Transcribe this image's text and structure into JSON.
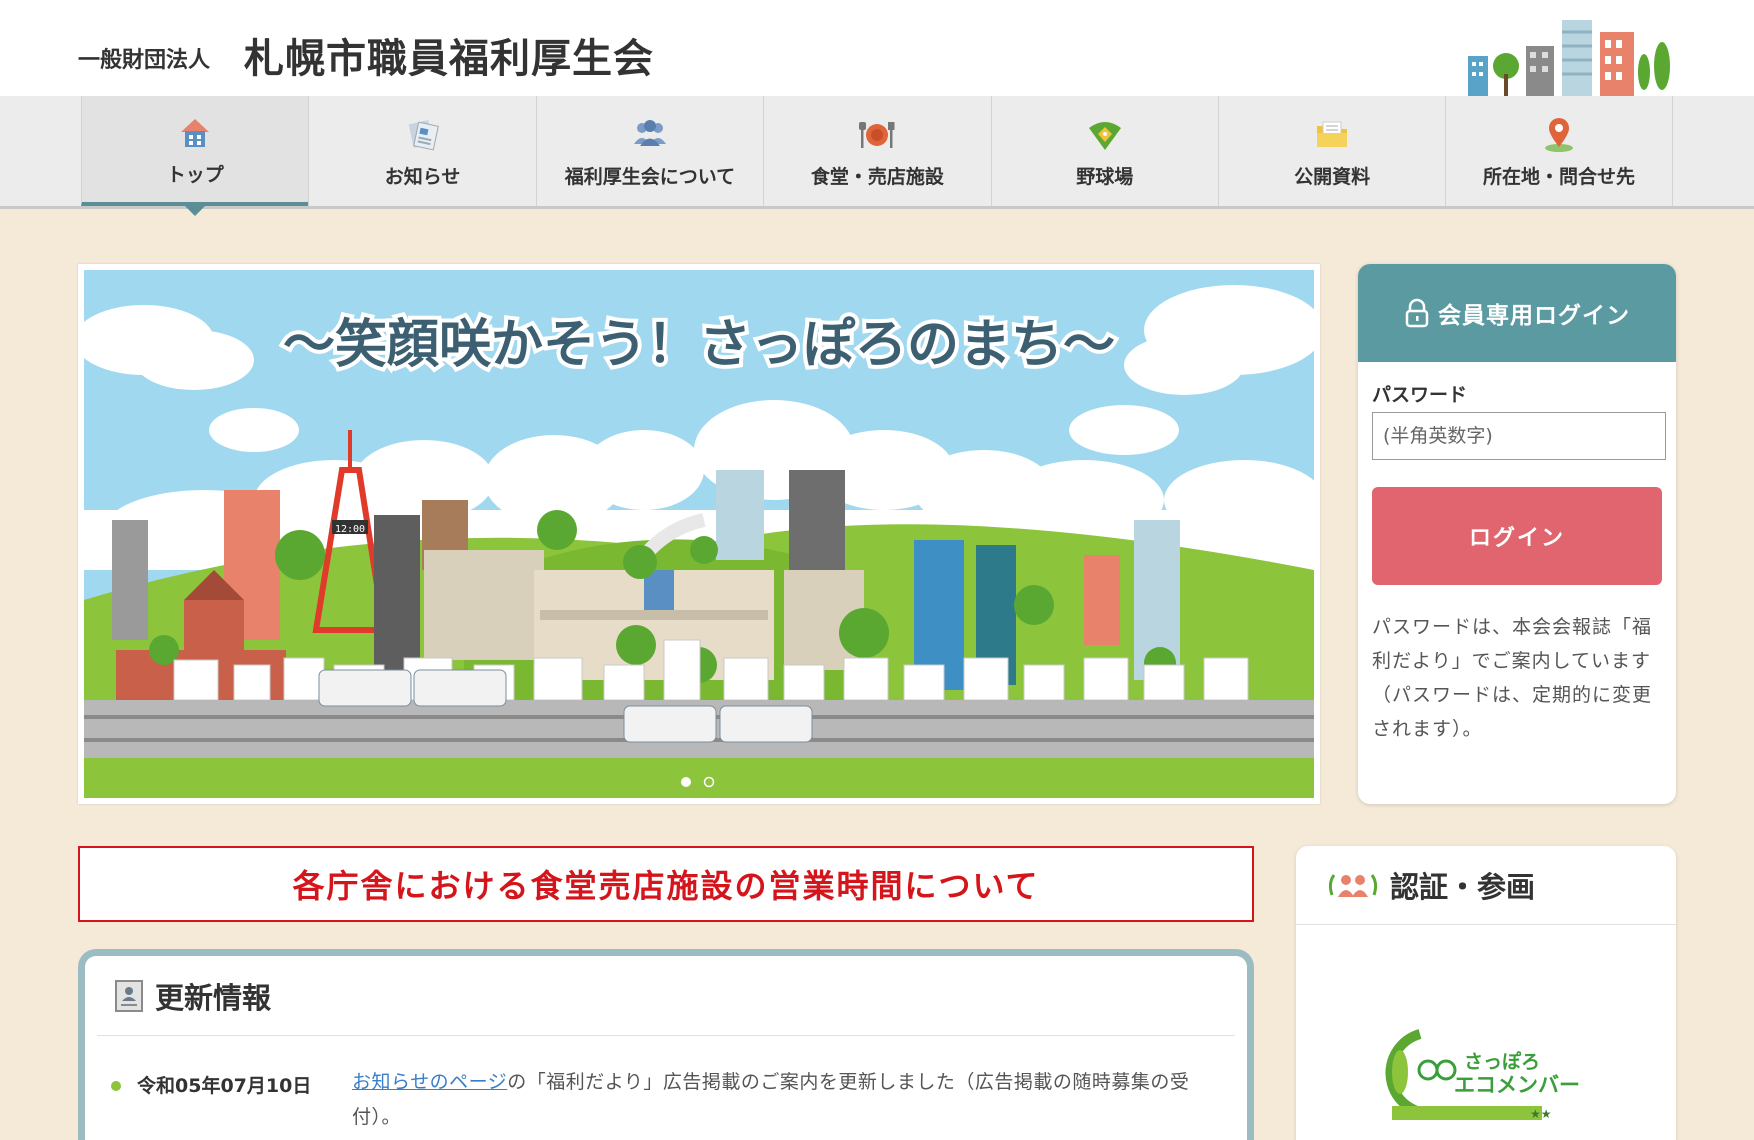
{
  "header": {
    "org_prefix": "一般財団法人",
    "org_name": "札幌市職員福利厚生会"
  },
  "nav": {
    "items": [
      {
        "label": "トップ",
        "icon": "house-icon",
        "active": true
      },
      {
        "label": "お知らせ",
        "icon": "newspaper-icon",
        "active": false
      },
      {
        "label": "福利厚生会について",
        "icon": "people-icon",
        "active": false
      },
      {
        "label": "食堂・売店施設",
        "icon": "dining-icon",
        "active": false
      },
      {
        "label": "野球場",
        "icon": "baseball-field-icon",
        "active": false
      },
      {
        "label": "公開資料",
        "icon": "folder-icon",
        "active": false
      },
      {
        "label": "所在地・問合せ先",
        "icon": "map-pin-icon",
        "active": false
      }
    ]
  },
  "slider": {
    "headline": "〜笑顔咲かそう！さっぽろのまち〜",
    "clock": "12:00",
    "total_slides": 2,
    "active_slide": 1
  },
  "login": {
    "title": "会員専用ログイン",
    "password_label": "パスワード",
    "password_placeholder": "(半角英数字)",
    "button_label": "ログイン",
    "note": "パスワードは、本会会報誌「福利だより」でご案内しています（パスワードは、定期的に変更されます）。"
  },
  "notice": {
    "text": "各庁舎における食堂売店施設の営業時間について"
  },
  "updates": {
    "title": "更新情報",
    "items": [
      {
        "date": "令和05年07月10日",
        "link_text": "お知らせのページ",
        "text": "の「福利だより」広告掲載のご案内を更新しました（広告掲載の随時募集の受付）。"
      }
    ]
  },
  "cert": {
    "title": "認証・参画",
    "logo_line1": "さっぽろ",
    "logo_line2": "エコメンバー",
    "logo_stars": "★★"
  },
  "colors": {
    "page_bg": "#f5e9d8",
    "accent_teal": "#5b9aa0",
    "login_button": "#e0656e",
    "notice_red": "#d4151c",
    "link_blue": "#3a7ec9"
  }
}
